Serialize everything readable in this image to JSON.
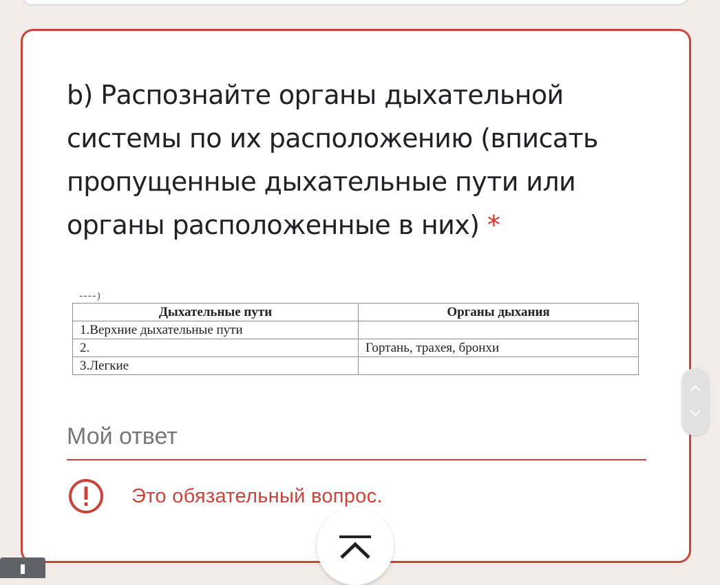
{
  "question": {
    "title": "b) Распознайте органы дыхательной системы по их расположению (вписать пропущенные дыхательные пути или органы расположенные в них)",
    "required_mark": "*",
    "image_table": {
      "headers": [
        "Дыхательные пути",
        "Органы дыхания"
      ],
      "rows": [
        [
          "1.Верхние дыхательные пути",
          ""
        ],
        [
          "2.",
          "Гортань, трахея, бронхи"
        ],
        [
          "3.Легкие",
          ""
        ]
      ]
    },
    "answer_placeholder": "Мой ответ",
    "error_message": "Это обязательный вопрос."
  },
  "icons": {
    "error": "error-exclamation-icon",
    "scroll_up": "chevron-up-icon",
    "scroll_down": "chevron-down-icon",
    "scroll_top": "scroll-to-top-icon"
  },
  "colors": {
    "error": "#c8443a",
    "required": "#d93025",
    "background": "#f2ebe8",
    "text": "#202124"
  }
}
